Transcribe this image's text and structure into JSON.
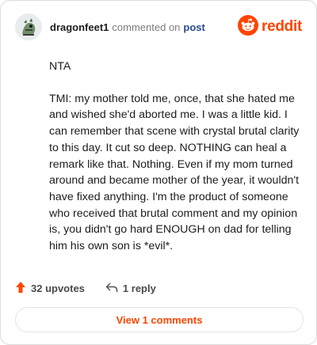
{
  "header": {
    "username": "dragonfeet1",
    "action_text": "commented on",
    "post_link": "post",
    "brand": "reddit"
  },
  "comment": {
    "paragraphs": [
      "NTA",
      "TMI: my mother told me, once, that she hated me and wished she'd aborted me. I was a little kid. I can remember that scene with crystal brutal clarity to this day. It cut so deep. NOTHING can heal a remark like that. Nothing. Even if my mom turned around and became mother of the year, it wouldn't have fixed anything. I'm the product of someone who received that brutal comment and my opinion is, you didn't go hard ENOUGH on dad for telling him his own son is *evil*."
    ]
  },
  "actions": {
    "upvotes": "32 upvotes",
    "replies": "1 reply"
  },
  "view_comments_label": "View 1 comments",
  "colors": {
    "brand": "#ff4500",
    "link": "#2a4b8d",
    "text": "#1c1c1c",
    "muted": "#7c7c7c"
  },
  "icons": {
    "avatar": "dragon-avatar-icon",
    "logo": "reddit-logo-icon",
    "upvote": "upvote-arrow-icon",
    "reply": "reply-arrow-icon"
  }
}
